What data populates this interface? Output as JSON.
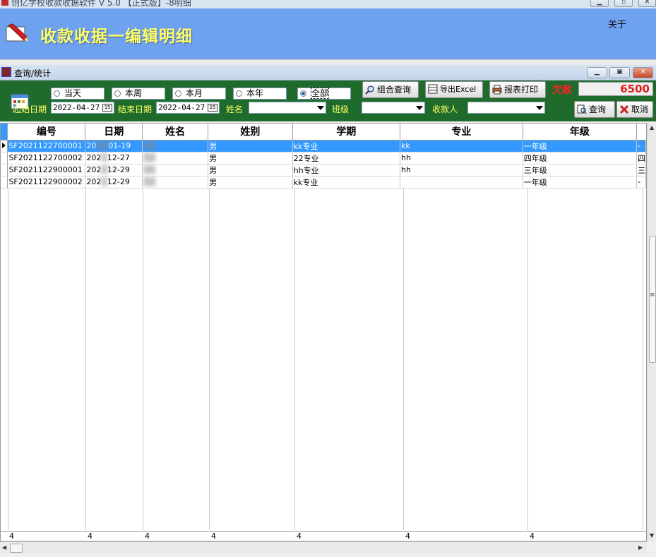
{
  "window": {
    "title": "创亿学校收款收据软件 V 5.0 【正式版】-8明细"
  },
  "banner": {
    "title": "收款收据一编辑明细",
    "about": "关于"
  },
  "child_window": {
    "title": "查询/统计"
  },
  "toolbar": {
    "radios": [
      {
        "label": "当天",
        "checked": false
      },
      {
        "label": "本周",
        "checked": false
      },
      {
        "label": "本月",
        "checked": false
      },
      {
        "label": "本年",
        "checked": false
      },
      {
        "label": "全部",
        "checked": true
      }
    ],
    "start_date_label": "起始日期",
    "start_date": "2022-04-27",
    "end_date_label": "结束日期",
    "end_date": "2022-04-27",
    "calendar_glyph": "15",
    "name_label": "姓名",
    "class_label": "班级",
    "payee_label": "收款人",
    "combo_query_button": "组合查询",
    "export_excel_button": "导出Excel",
    "print_button": "报表打印",
    "arrears_label": "欠款",
    "arrears_value": "6500",
    "query_button": "查询",
    "cancel_button": "取消"
  },
  "grid": {
    "columns": [
      "编号",
      "日期",
      "姓名",
      "姓别",
      "学期",
      "专业",
      "年级"
    ],
    "rows": [
      {
        "id": "SF2021122700001",
        "date_a": "20",
        "date_b": "01-19",
        "name": "",
        "gender": "男",
        "term": "kk专业",
        "major": "kk",
        "grade": "一年级",
        "extra": "-"
      },
      {
        "id": "SF2021122700002",
        "date_a": "202",
        "date_b": "12-27",
        "name": "",
        "gender": "男",
        "term": "22专业",
        "major": "hh",
        "grade": "四年级",
        "extra": "四"
      },
      {
        "id": "SF2021122900001",
        "date_a": "202",
        "date_b": "12-29",
        "name": "",
        "gender": "男",
        "term": "hh专业",
        "major": "hh",
        "grade": "三年级",
        "extra": "三"
      },
      {
        "id": "SF2021122900002",
        "date_a": "202",
        "date_b": "12-29",
        "name": "",
        "gender": "男",
        "term": "kk专业",
        "major": "",
        "grade": "一年级",
        "extra": "-"
      }
    ],
    "summary": [
      "4",
      "4",
      "4",
      "4",
      "4",
      "4",
      "4"
    ]
  }
}
